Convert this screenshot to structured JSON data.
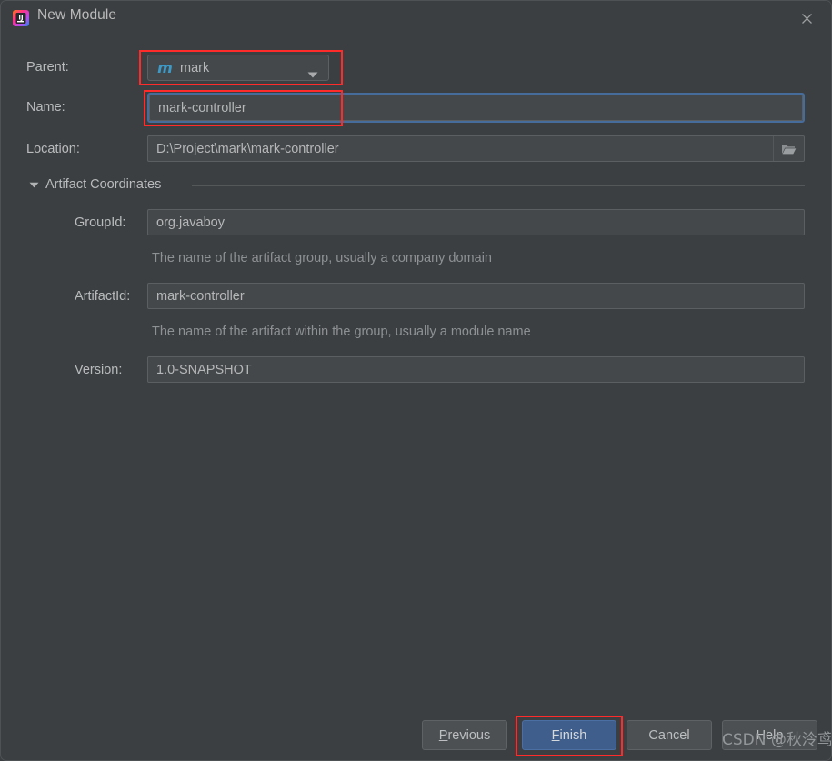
{
  "window": {
    "title": "New Module",
    "app_icon": "intellij-idea-icon",
    "close_icon": "close-icon",
    "background_color": "#3c3f41"
  },
  "form": {
    "parent": {
      "label": "Parent:",
      "value": "mark",
      "icon": "maven-module-icon",
      "icon_glyph": "m",
      "icon_color": "#3d9ac7",
      "dropdown_icon": "chevron-down-icon"
    },
    "name": {
      "label": "Name:",
      "value": "mark-controller",
      "placeholder": "",
      "focused": true,
      "focus_color": "#466c9c"
    },
    "location": {
      "label": "Location:",
      "value": "D:\\Project\\mark\\mark-controller",
      "placeholder": "",
      "browse_icon": "folder-open-icon"
    }
  },
  "artifact_coordinates": {
    "section_title": "Artifact Coordinates",
    "expander_icon": "triangle-down-icon",
    "expanded": true,
    "fields": [
      {
        "label": "GroupId:",
        "value": "org.javaboy",
        "hint": "The name of the artifact group, usually a company domain"
      },
      {
        "label": "ArtifactId:",
        "value": "mark-controller",
        "hint": "The name of the artifact within the group, usually a module name"
      },
      {
        "label": "Version:",
        "value": "1.0-SNAPSHOT",
        "hint": ""
      }
    ]
  },
  "buttons": {
    "previous": {
      "label_mnemonic": "P",
      "label_rest": "revious"
    },
    "finish": {
      "label_mnemonic": "F",
      "label_rest": "inish",
      "primary": true,
      "color": "#3f5e8c"
    },
    "cancel": {
      "label": "Cancel"
    },
    "help": {
      "label": "Help"
    }
  },
  "annotations": {
    "color": "#ff2a2a",
    "boxes": [
      "parent-combo",
      "name-field",
      "finish-button"
    ]
  },
  "watermark": {
    "text": "CSDN @秋泠鸢"
  }
}
